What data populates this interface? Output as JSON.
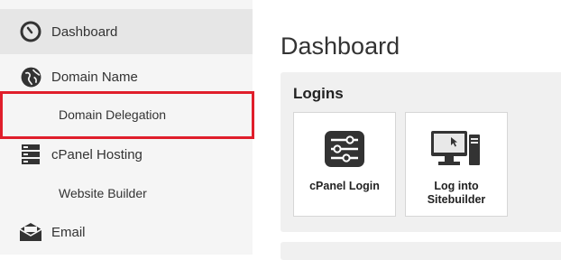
{
  "sidebar": {
    "items": [
      {
        "label": "Dashboard",
        "icon": "dashboard-gauge-icon"
      },
      {
        "label": "Domain Name",
        "icon": "globe-icon"
      },
      {
        "label": "Domain Delegation"
      },
      {
        "label": "cPanel Hosting",
        "icon": "server-icon"
      },
      {
        "label": "Website Builder"
      },
      {
        "label": "Email",
        "icon": "envelope-icon"
      }
    ]
  },
  "main": {
    "title": "Dashboard",
    "logins": {
      "title": "Logins",
      "tiles": [
        {
          "label": "cPanel Login",
          "icon": "cpanel-sliders-icon"
        },
        {
          "label": "Log into\nSitebuilder",
          "icon": "desktop-computer-icon"
        }
      ]
    }
  },
  "colors": {
    "highlight_border": "#e01e2b",
    "sidebar_bg": "#f5f5f5",
    "active_bg": "#e6e6e6",
    "icon_dark": "#333333"
  }
}
